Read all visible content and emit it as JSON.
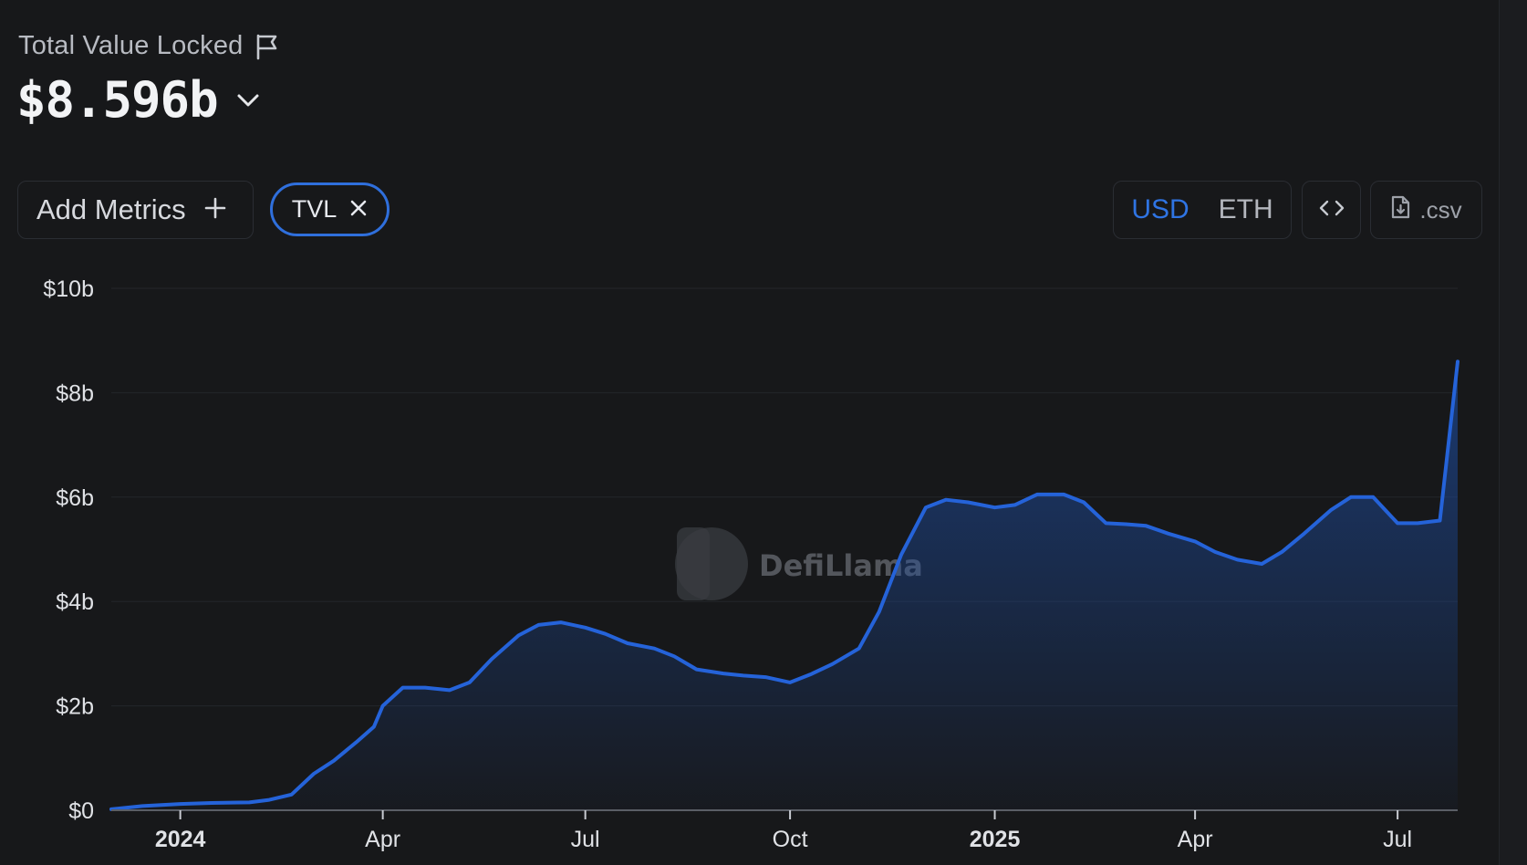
{
  "header": {
    "tvl_label": "Total Value Locked",
    "tvl_value": "$8.596b"
  },
  "toolbar": {
    "add_metrics_label": "Add Metrics",
    "chip_label": "TVL",
    "currency_options": [
      "USD",
      "ETH"
    ],
    "currency_selected": "USD",
    "csv_label": ".csv"
  },
  "colors": {
    "accent": "#2f6fdc",
    "background": "#17181a",
    "line": "#2563d9"
  },
  "watermark": "DefiLlama",
  "chart_data": {
    "type": "area",
    "series": [
      {
        "name": "TVL",
        "x": [
          "2023-12-01",
          "2023-12-15",
          "2024-01-01",
          "2024-01-15",
          "2024-02-01",
          "2024-02-10",
          "2024-02-20",
          "2024-03-01",
          "2024-03-10",
          "2024-03-20",
          "2024-03-28",
          "2024-04-01",
          "2024-04-10",
          "2024-04-20",
          "2024-05-01",
          "2024-05-10",
          "2024-05-20",
          "2024-06-01",
          "2024-06-10",
          "2024-06-20",
          "2024-07-01",
          "2024-07-10",
          "2024-07-20",
          "2024-08-01",
          "2024-08-10",
          "2024-08-20",
          "2024-09-01",
          "2024-09-10",
          "2024-09-20",
          "2024-10-01",
          "2024-10-10",
          "2024-10-20",
          "2024-11-01",
          "2024-11-10",
          "2024-11-20",
          "2024-12-01",
          "2024-12-10",
          "2024-12-20",
          "2025-01-01",
          "2025-01-10",
          "2025-01-20",
          "2025-02-01",
          "2025-02-10",
          "2025-02-20",
          "2025-03-01",
          "2025-03-10",
          "2025-03-20",
          "2025-04-01",
          "2025-04-10",
          "2025-04-20",
          "2025-05-01",
          "2025-05-10",
          "2025-05-20",
          "2025-06-01",
          "2025-06-10",
          "2025-06-20",
          "2025-07-01",
          "2025-07-10",
          "2025-07-20",
          "2025-07-28"
        ],
        "values": [
          0.02,
          0.08,
          0.12,
          0.14,
          0.15,
          0.2,
          0.3,
          0.7,
          0.95,
          1.3,
          1.6,
          2.0,
          2.35,
          2.35,
          2.3,
          2.45,
          2.9,
          3.35,
          3.55,
          3.6,
          3.5,
          3.38,
          3.2,
          3.1,
          2.95,
          2.7,
          2.62,
          2.58,
          2.55,
          2.45,
          2.6,
          2.8,
          3.1,
          3.8,
          4.9,
          5.8,
          5.95,
          5.9,
          5.8,
          5.85,
          6.05,
          6.05,
          5.9,
          5.5,
          5.48,
          5.45,
          5.3,
          5.15,
          4.95,
          4.8,
          4.72,
          4.95,
          5.3,
          5.75,
          6.0,
          6.0,
          5.5,
          5.5,
          5.55,
          8.596
        ]
      }
    ],
    "x_ticks": [
      "2024",
      "Apr",
      "Jul",
      "Oct",
      "2025",
      "Apr",
      "Jul"
    ],
    "y_ticks": [
      "$0",
      "$2b",
      "$4b",
      "$6b",
      "$8b",
      "$10b"
    ],
    "ylim": [
      0,
      10
    ],
    "xlim": [
      "2023-12-01",
      "2025-07-28"
    ],
    "grid": true
  }
}
